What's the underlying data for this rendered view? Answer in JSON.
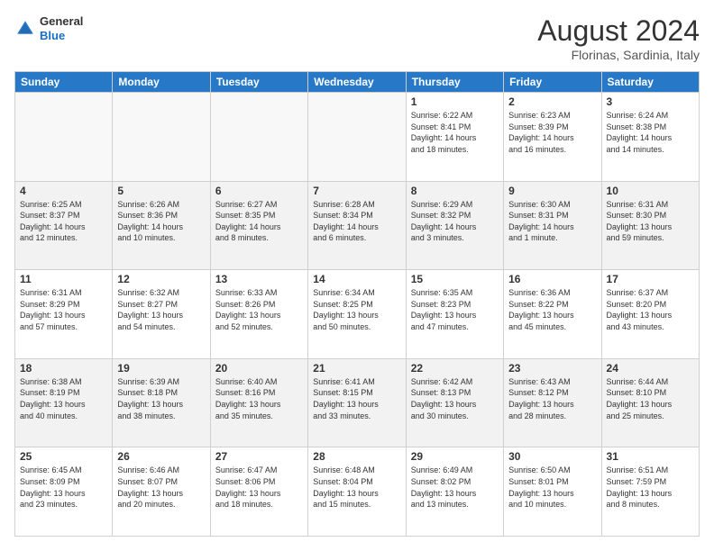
{
  "header": {
    "logo": {
      "general": "General",
      "blue": "Blue"
    },
    "title": "August 2024",
    "location": "Florinas, Sardinia, Italy"
  },
  "days_of_week": [
    "Sunday",
    "Monday",
    "Tuesday",
    "Wednesday",
    "Thursday",
    "Friday",
    "Saturday"
  ],
  "weeks": [
    {
      "row_class": "row-odd",
      "days": [
        {
          "num": "",
          "info": "",
          "empty": true
        },
        {
          "num": "",
          "info": "",
          "empty": true
        },
        {
          "num": "",
          "info": "",
          "empty": true
        },
        {
          "num": "",
          "info": "",
          "empty": true
        },
        {
          "num": "1",
          "info": "Sunrise: 6:22 AM\nSunset: 8:41 PM\nDaylight: 14 hours\nand 18 minutes."
        },
        {
          "num": "2",
          "info": "Sunrise: 6:23 AM\nSunset: 8:39 PM\nDaylight: 14 hours\nand 16 minutes."
        },
        {
          "num": "3",
          "info": "Sunrise: 6:24 AM\nSunset: 8:38 PM\nDaylight: 14 hours\nand 14 minutes."
        }
      ]
    },
    {
      "row_class": "row-even",
      "days": [
        {
          "num": "4",
          "info": "Sunrise: 6:25 AM\nSunset: 8:37 PM\nDaylight: 14 hours\nand 12 minutes."
        },
        {
          "num": "5",
          "info": "Sunrise: 6:26 AM\nSunset: 8:36 PM\nDaylight: 14 hours\nand 10 minutes."
        },
        {
          "num": "6",
          "info": "Sunrise: 6:27 AM\nSunset: 8:35 PM\nDaylight: 14 hours\nand 8 minutes."
        },
        {
          "num": "7",
          "info": "Sunrise: 6:28 AM\nSunset: 8:34 PM\nDaylight: 14 hours\nand 6 minutes."
        },
        {
          "num": "8",
          "info": "Sunrise: 6:29 AM\nSunset: 8:32 PM\nDaylight: 14 hours\nand 3 minutes."
        },
        {
          "num": "9",
          "info": "Sunrise: 6:30 AM\nSunset: 8:31 PM\nDaylight: 14 hours\nand 1 minute."
        },
        {
          "num": "10",
          "info": "Sunrise: 6:31 AM\nSunset: 8:30 PM\nDaylight: 13 hours\nand 59 minutes."
        }
      ]
    },
    {
      "row_class": "row-odd",
      "days": [
        {
          "num": "11",
          "info": "Sunrise: 6:31 AM\nSunset: 8:29 PM\nDaylight: 13 hours\nand 57 minutes."
        },
        {
          "num": "12",
          "info": "Sunrise: 6:32 AM\nSunset: 8:27 PM\nDaylight: 13 hours\nand 54 minutes."
        },
        {
          "num": "13",
          "info": "Sunrise: 6:33 AM\nSunset: 8:26 PM\nDaylight: 13 hours\nand 52 minutes."
        },
        {
          "num": "14",
          "info": "Sunrise: 6:34 AM\nSunset: 8:25 PM\nDaylight: 13 hours\nand 50 minutes."
        },
        {
          "num": "15",
          "info": "Sunrise: 6:35 AM\nSunset: 8:23 PM\nDaylight: 13 hours\nand 47 minutes."
        },
        {
          "num": "16",
          "info": "Sunrise: 6:36 AM\nSunset: 8:22 PM\nDaylight: 13 hours\nand 45 minutes."
        },
        {
          "num": "17",
          "info": "Sunrise: 6:37 AM\nSunset: 8:20 PM\nDaylight: 13 hours\nand 43 minutes."
        }
      ]
    },
    {
      "row_class": "row-even",
      "days": [
        {
          "num": "18",
          "info": "Sunrise: 6:38 AM\nSunset: 8:19 PM\nDaylight: 13 hours\nand 40 minutes."
        },
        {
          "num": "19",
          "info": "Sunrise: 6:39 AM\nSunset: 8:18 PM\nDaylight: 13 hours\nand 38 minutes."
        },
        {
          "num": "20",
          "info": "Sunrise: 6:40 AM\nSunset: 8:16 PM\nDaylight: 13 hours\nand 35 minutes."
        },
        {
          "num": "21",
          "info": "Sunrise: 6:41 AM\nSunset: 8:15 PM\nDaylight: 13 hours\nand 33 minutes."
        },
        {
          "num": "22",
          "info": "Sunrise: 6:42 AM\nSunset: 8:13 PM\nDaylight: 13 hours\nand 30 minutes."
        },
        {
          "num": "23",
          "info": "Sunrise: 6:43 AM\nSunset: 8:12 PM\nDaylight: 13 hours\nand 28 minutes."
        },
        {
          "num": "24",
          "info": "Sunrise: 6:44 AM\nSunset: 8:10 PM\nDaylight: 13 hours\nand 25 minutes."
        }
      ]
    },
    {
      "row_class": "row-odd",
      "days": [
        {
          "num": "25",
          "info": "Sunrise: 6:45 AM\nSunset: 8:09 PM\nDaylight: 13 hours\nand 23 minutes."
        },
        {
          "num": "26",
          "info": "Sunrise: 6:46 AM\nSunset: 8:07 PM\nDaylight: 13 hours\nand 20 minutes."
        },
        {
          "num": "27",
          "info": "Sunrise: 6:47 AM\nSunset: 8:06 PM\nDaylight: 13 hours\nand 18 minutes."
        },
        {
          "num": "28",
          "info": "Sunrise: 6:48 AM\nSunset: 8:04 PM\nDaylight: 13 hours\nand 15 minutes."
        },
        {
          "num": "29",
          "info": "Sunrise: 6:49 AM\nSunset: 8:02 PM\nDaylight: 13 hours\nand 13 minutes."
        },
        {
          "num": "30",
          "info": "Sunrise: 6:50 AM\nSunset: 8:01 PM\nDaylight: 13 hours\nand 10 minutes."
        },
        {
          "num": "31",
          "info": "Sunrise: 6:51 AM\nSunset: 7:59 PM\nDaylight: 13 hours\nand 8 minutes."
        }
      ]
    }
  ]
}
